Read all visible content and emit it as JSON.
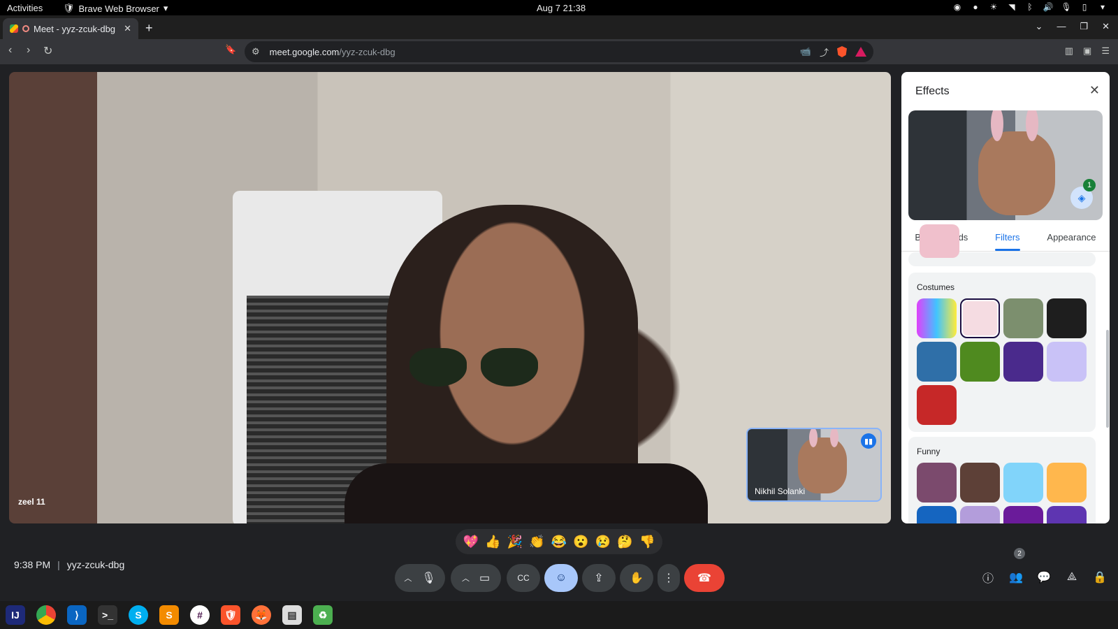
{
  "topbar": {
    "activities": "Activities",
    "app_name": "Brave Web Browser",
    "clock": "Aug 7  21:38"
  },
  "browser": {
    "tab_title": "Meet - yyz-zcuk-dbg",
    "url_host": "meet.google.com",
    "url_path": "/yyz-zcuk-dbg"
  },
  "meet": {
    "main_participant": "zeel 11",
    "self_name": "Nikhil Solanki",
    "time": "9:38 PM",
    "meeting_code": "yyz-zcuk-dbg",
    "participant_count": "2",
    "reactions": [
      "💖",
      "👍",
      "🎉",
      "👏",
      "😂",
      "😮",
      "😢",
      "🤔",
      "👎"
    ]
  },
  "effects": {
    "title": "Effects",
    "applied_count": "1",
    "tabs": [
      "Backgrounds",
      "Filters",
      "Appearance"
    ],
    "active_tab": "Filters",
    "sections": [
      {
        "label": "Costumes"
      },
      {
        "label": "Funny"
      }
    ]
  },
  "colors": {
    "accent": "#1a73e8",
    "end_call": "#ea4335",
    "active_control": "#a8c7fa"
  }
}
